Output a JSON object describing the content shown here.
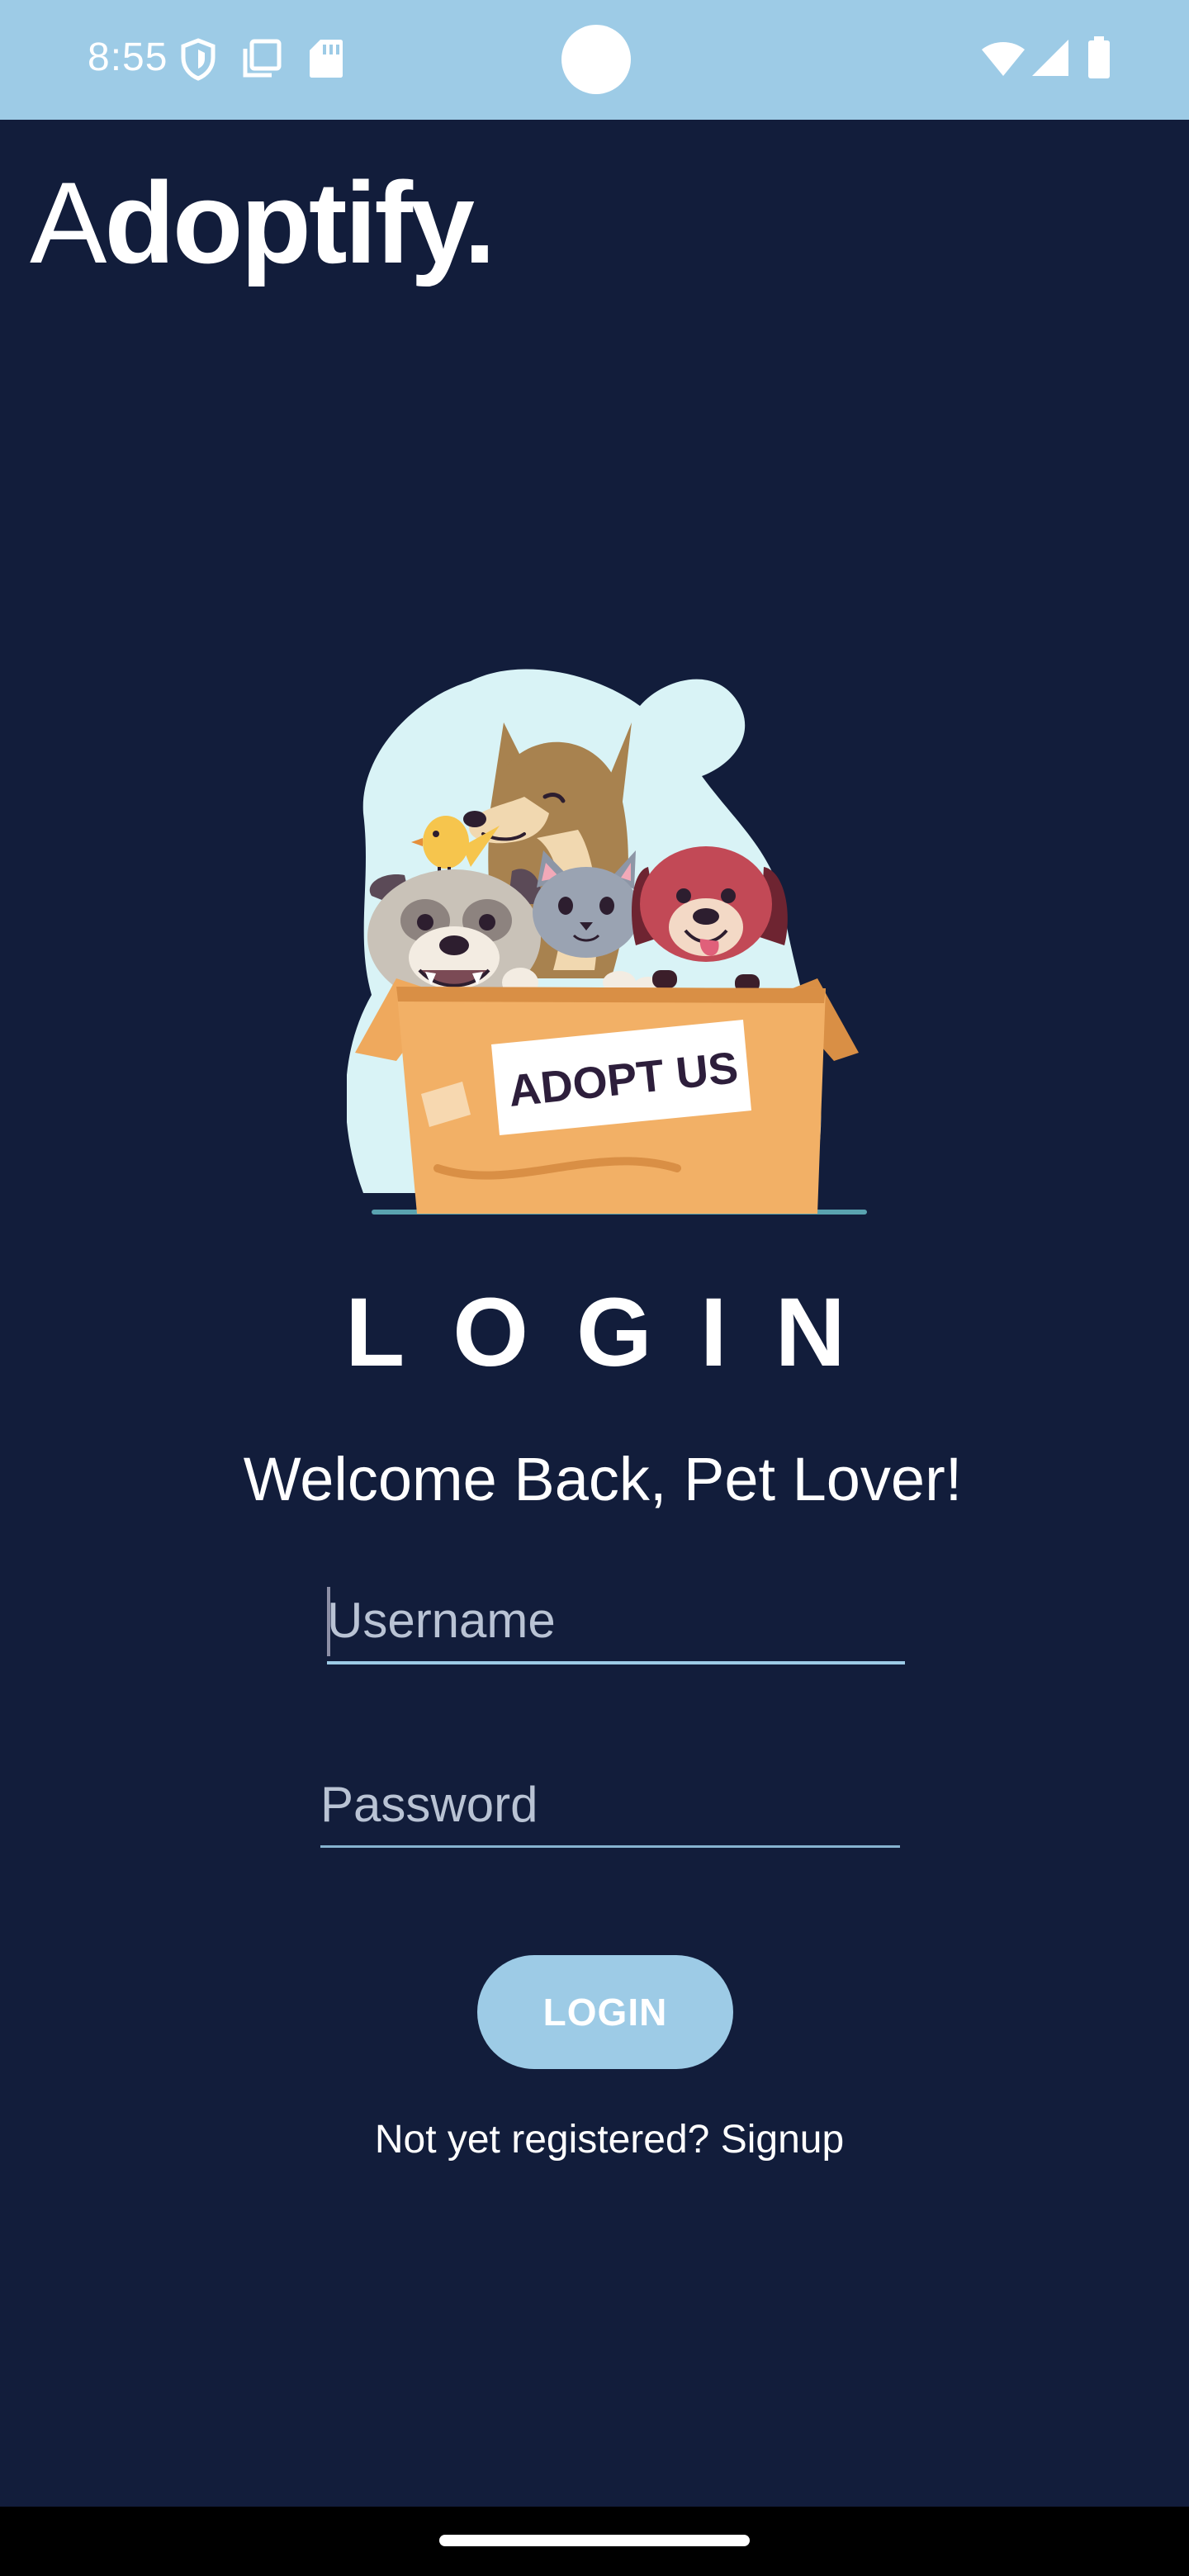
{
  "status_bar": {
    "time": "8:55",
    "left_icons": [
      "shield-icon",
      "copy-icon",
      "sd-card-icon"
    ],
    "right_icons": [
      "wifi-icon",
      "signal-icon",
      "battery-icon"
    ],
    "background_color": "#9dcbe6"
  },
  "header": {
    "title_prefix": "A",
    "title_rest": "doptify."
  },
  "hero": {
    "sign_text": "ADOPT US"
  },
  "login": {
    "heading": "LOGIN",
    "welcome": "Welcome Back, Pet Lover!",
    "username_placeholder": "Username",
    "password_placeholder": "Password",
    "button_label": "LOGIN",
    "signup_text": "Not yet registered? Signup"
  },
  "theme": {
    "background": "#121d3b",
    "accent": "#9dcbe6",
    "text": "#ffffff"
  }
}
